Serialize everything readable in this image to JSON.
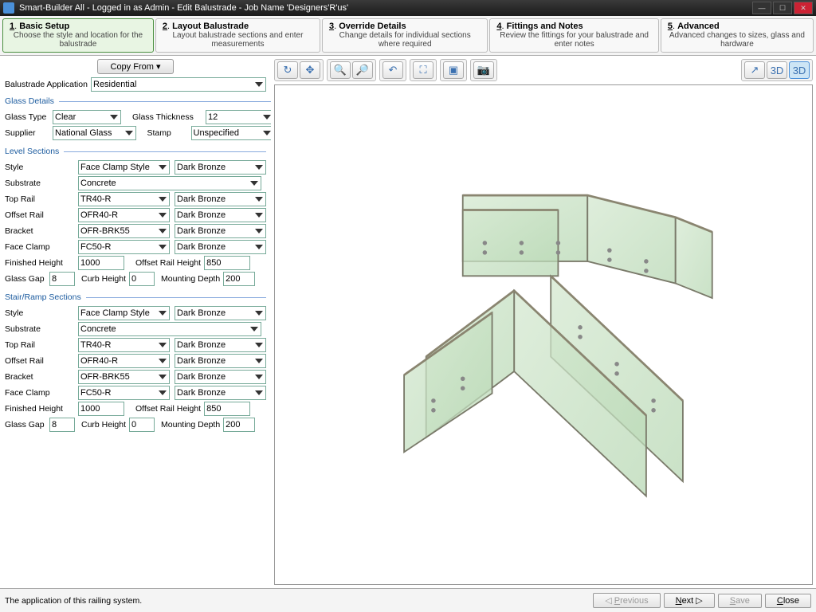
{
  "title": "Smart-Builder All - Logged in as Admin - Edit Balustrade - Job Name 'Designers'R'us'",
  "tabs": [
    {
      "num": "1",
      "name": "Basic Setup",
      "desc": "Choose the style and location for the balustrade"
    },
    {
      "num": "2",
      "name": "Layout Balustrade",
      "desc": "Layout balustrade sections and enter measurements"
    },
    {
      "num": "3",
      "name": "Override Details",
      "desc": "Change details for individual sections where required"
    },
    {
      "num": "4",
      "name": "Fittings and Notes",
      "desc": "Review the fittings for your balustrade and enter notes"
    },
    {
      "num": "5",
      "name": "Advanced",
      "desc": "Advanced changes to sizes, glass and hardware"
    }
  ],
  "copyFrom": "Copy From  ▾",
  "balApp": {
    "label": "Balustrade Application",
    "value": "Residential"
  },
  "glassDetails": {
    "legend": "Glass Details",
    "glassType": {
      "label": "Glass Type",
      "value": "Clear"
    },
    "glassThickness": {
      "label": "Glass Thickness",
      "value": "12"
    },
    "supplier": {
      "label": "Supplier",
      "value": "National Glass"
    },
    "stamp": {
      "label": "Stamp",
      "value": "Unspecified"
    }
  },
  "level": {
    "legend": "Level Sections",
    "style": {
      "label": "Style",
      "v": "Face Clamp Style",
      "c": "Dark Bronze"
    },
    "substrate": {
      "label": "Substrate",
      "v": "Concrete"
    },
    "topRail": {
      "label": "Top Rail",
      "v": "TR40-R",
      "c": "Dark Bronze"
    },
    "offsetRail": {
      "label": "Offset Rail",
      "v": "OFR40-R",
      "c": "Dark Bronze"
    },
    "bracket": {
      "label": "Bracket",
      "v": "OFR-BRK55",
      "c": "Dark Bronze"
    },
    "faceClamp": {
      "label": "Face Clamp",
      "v": "FC50-R",
      "c": "Dark Bronze"
    },
    "finishedHeight": {
      "label": "Finished Height",
      "v": "1000"
    },
    "offsetRailHeight": {
      "label": "Offset Rail Height",
      "v": "850"
    },
    "glassGap": {
      "label": "Glass Gap",
      "v": "8"
    },
    "curbHeight": {
      "label": "Curb Height",
      "v": "0"
    },
    "mountingDepth": {
      "label": "Mounting Depth",
      "v": "200"
    }
  },
  "stair": {
    "legend": "Stair/Ramp Sections",
    "style": {
      "label": "Style",
      "v": "Face Clamp Style",
      "c": "Dark Bronze"
    },
    "substrate": {
      "label": "Substrate",
      "v": "Concrete"
    },
    "topRail": {
      "label": "Top Rail",
      "v": "TR40-R",
      "c": "Dark Bronze"
    },
    "offsetRail": {
      "label": "Offset Rail",
      "v": "OFR40-R",
      "c": "Dark Bronze"
    },
    "bracket": {
      "label": "Bracket",
      "v": "OFR-BRK55",
      "c": "Dark Bronze"
    },
    "faceClamp": {
      "label": "Face Clamp",
      "v": "FC50-R",
      "c": "Dark Bronze"
    },
    "finishedHeight": {
      "label": "Finished Height",
      "v": "1000"
    },
    "offsetRailHeight": {
      "label": "Offset Rail Height",
      "v": "850"
    },
    "glassGap": {
      "label": "Glass Gap",
      "v": "8"
    },
    "curbHeight": {
      "label": "Curb Height",
      "v": "0"
    },
    "mountingDepth": {
      "label": "Mounting Depth",
      "v": "200"
    }
  },
  "footer": {
    "status": "The application of this railing system.",
    "prev": "Previous",
    "next": "Next",
    "save": "Save",
    "close": "Close"
  },
  "viewBtns": {
    "iso": "3D",
    "iso2": "3D"
  }
}
